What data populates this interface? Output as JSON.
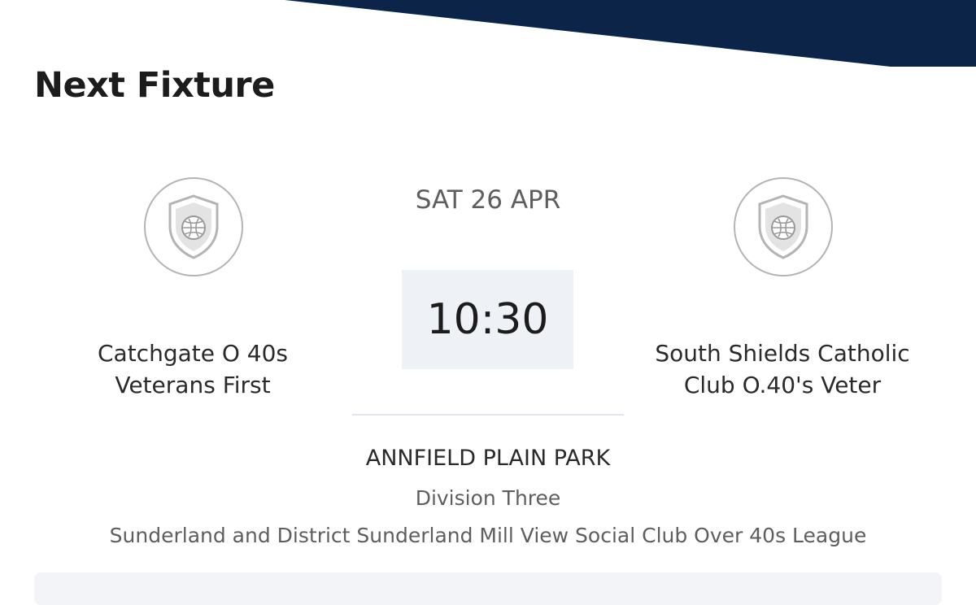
{
  "section": {
    "title": "Next Fixture"
  },
  "fixture": {
    "date": "SAT 26 APR",
    "kickoff": "10:30",
    "home_team": {
      "name_line1": "Catchgate O 40s",
      "name_line2": "Veterans First",
      "crest_icon": "shield-football-icon"
    },
    "away_team": {
      "name_line1": "South Shields Catholic",
      "name_line2": "Club O.40's Veter",
      "crest_icon": "shield-football-icon"
    },
    "venue": "ANNFIELD PLAIN PARK",
    "division": "Division Three",
    "league": "Sunderland and District Sunderland Mill View Social Club Over 40s League"
  },
  "colors": {
    "banner_navy": "#0c2447",
    "kickoff_bg": "#eef1f5",
    "crest_grey": "#b4b4b4"
  }
}
